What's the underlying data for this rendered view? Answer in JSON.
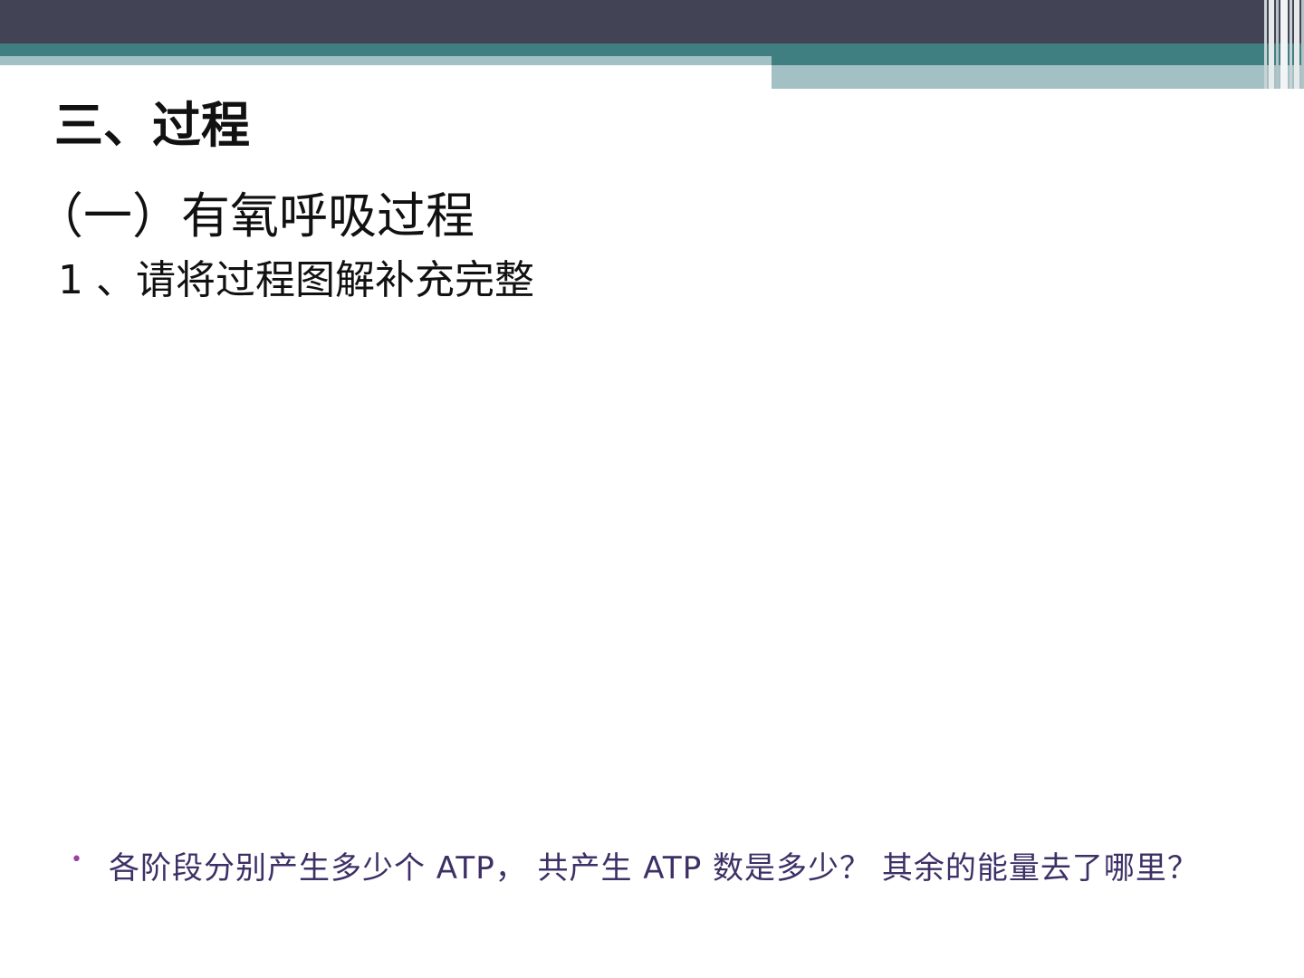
{
  "colors": {
    "header_dark": "#434356",
    "header_teal": "#3f7f82",
    "header_light": "#a3c1c4",
    "bullet": "#9b3fa6",
    "question_text": "#3d3066",
    "heading_text": "#111111"
  },
  "slide": {
    "title": "三、过程",
    "subtitle": "（一）有氧呼吸过程",
    "step": "1 、请将过程图解补充完整",
    "bullet_icon": "bullet-dot-icon",
    "bullet_glyph": "•",
    "question": "各阶段分别产生多少个 ATP， 共产生 ATP 数是多少？ 其余的能量去了哪里？"
  }
}
